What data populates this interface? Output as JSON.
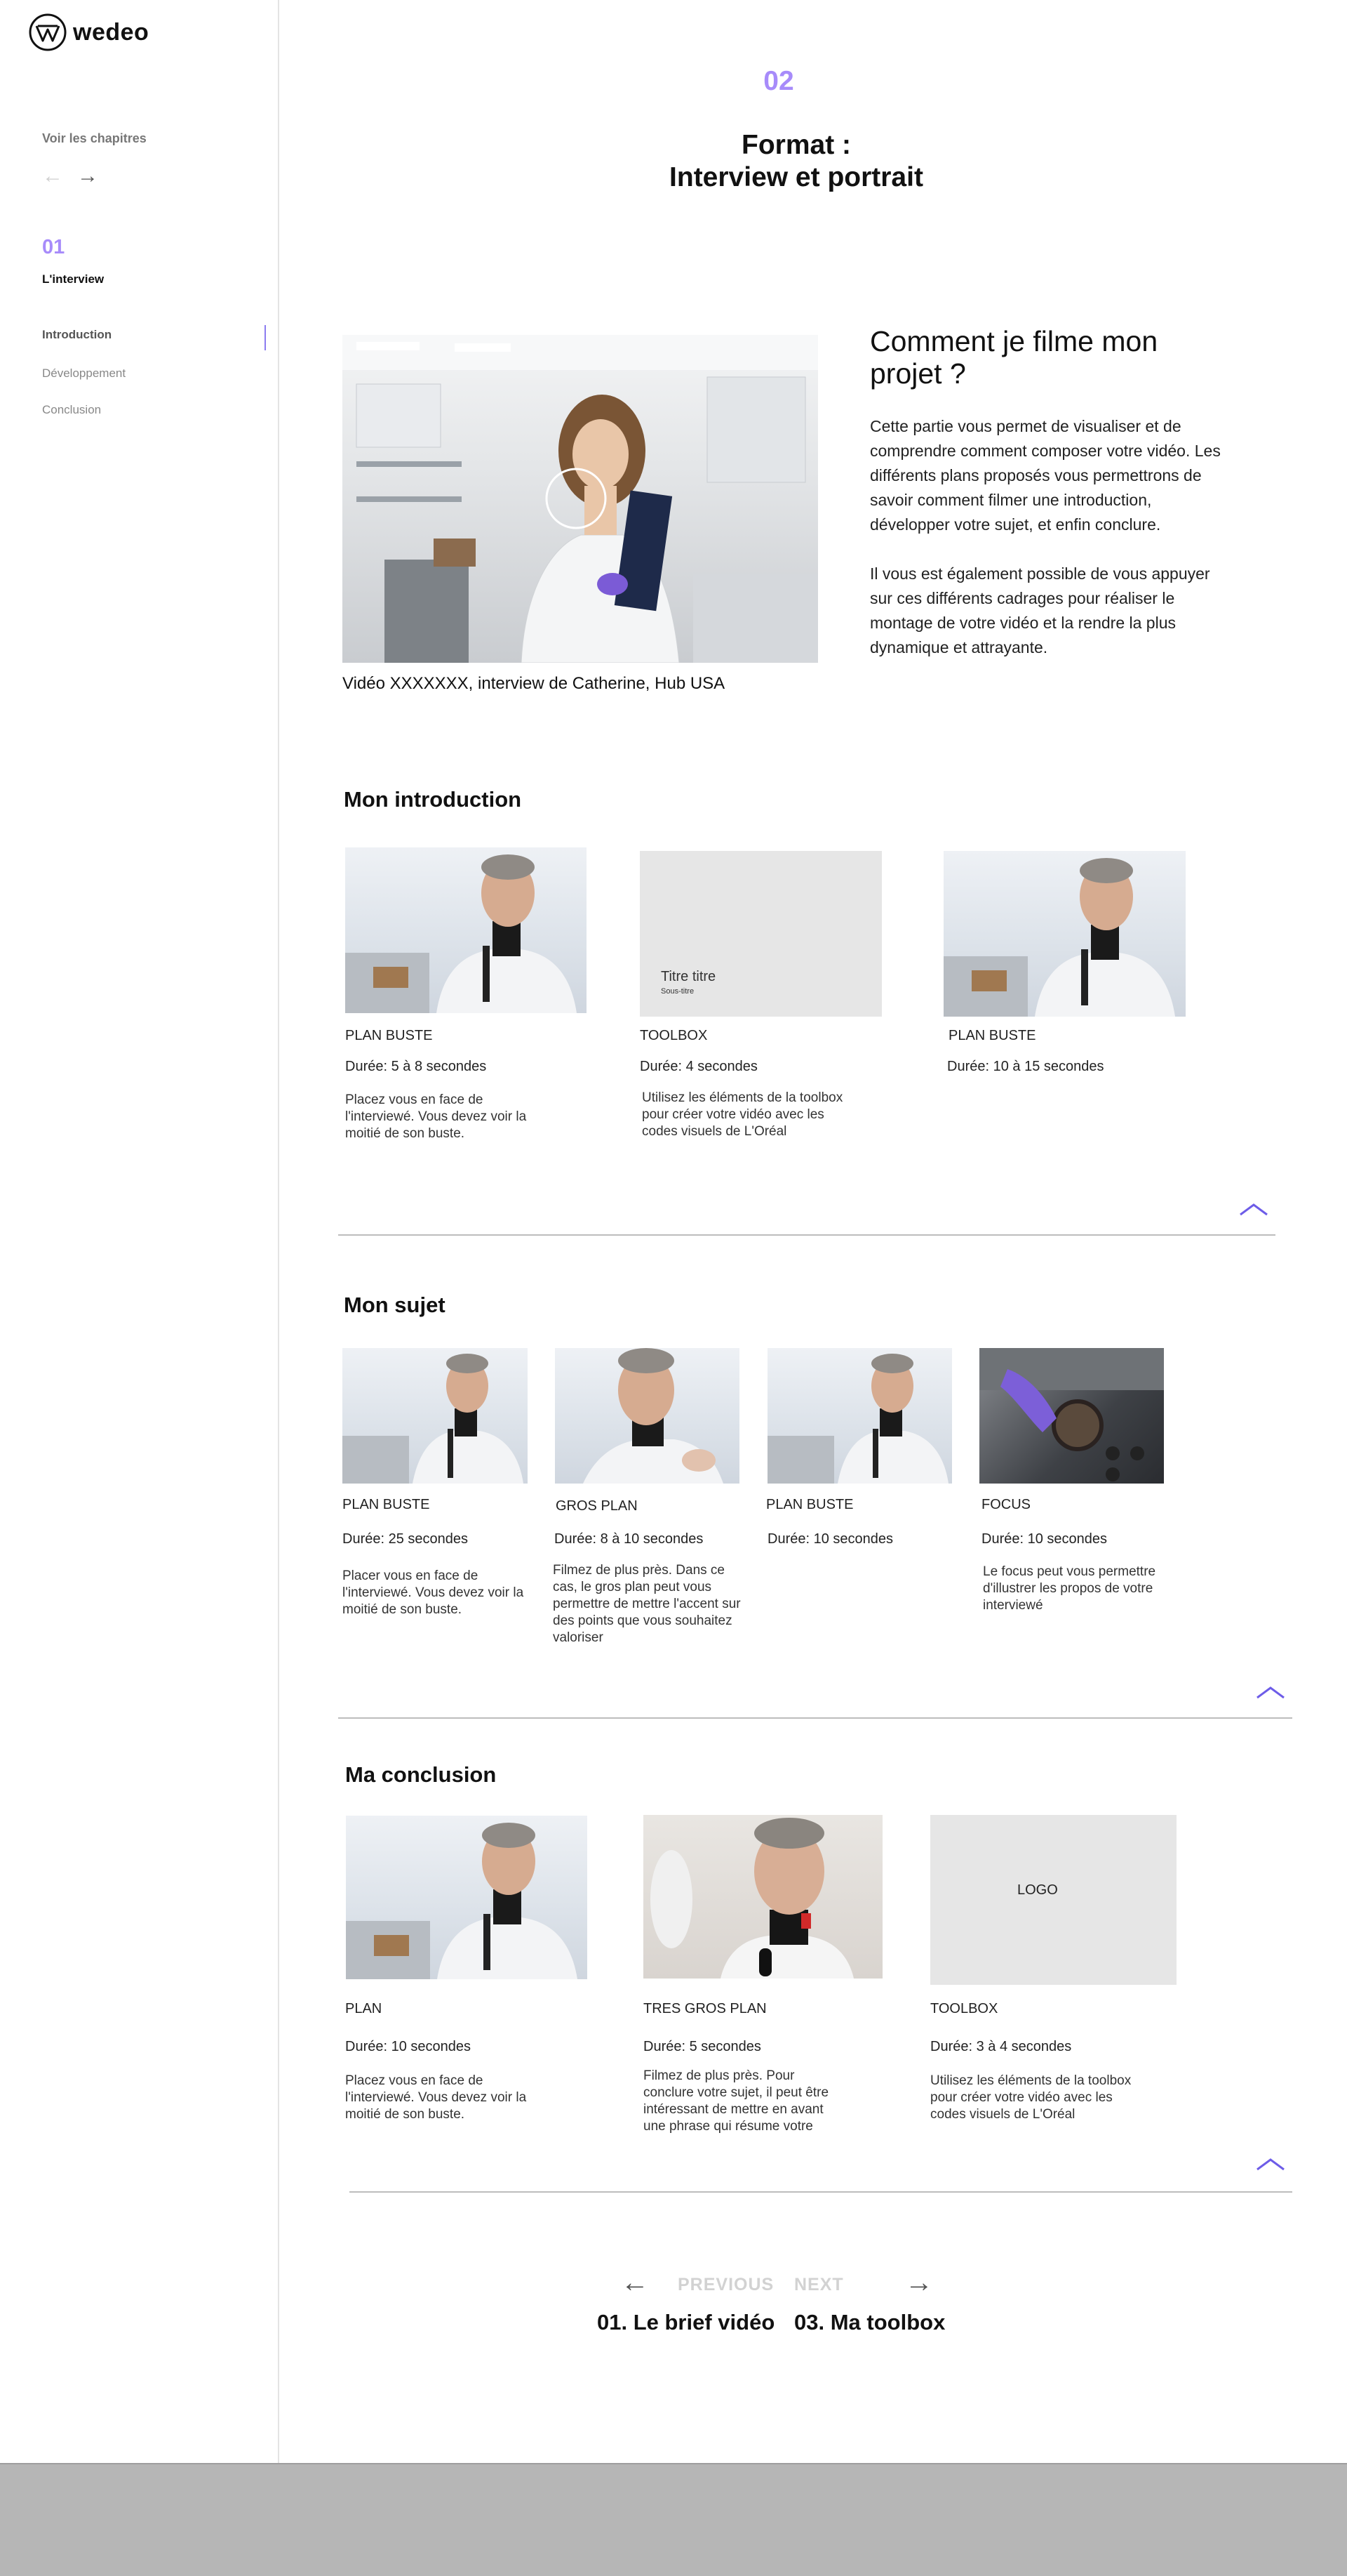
{
  "brand": {
    "name": "wedeo"
  },
  "sidebar": {
    "see_chapters": "Voir les chapitres",
    "prev_arrow": "←",
    "next_arrow": "→",
    "chapter_num": "01",
    "chapter_title": "L'interview",
    "items": [
      {
        "label": "Introduction",
        "active": true
      },
      {
        "label": "Développement",
        "active": false
      },
      {
        "label": "Conclusion",
        "active": false
      }
    ]
  },
  "header": {
    "section_num": "02",
    "title_line1": "Format :",
    "title_line2": "Interview et portrait"
  },
  "intro": {
    "heading": "Comment je filme mon projet ?",
    "p1": "Cette partie vous permet de visualiser et de comprendre comment composer votre vidéo. Les différents plans proposés vous permettrons de savoir comment filmer une introduction, développer votre sujet, et enfin conclure.",
    "p2": "Il vous est également possible de vous appuyer sur ces différents cadrages pour réaliser le montage de votre vidéo et la rendre la plus dynamique et attrayante.",
    "caption": "Vidéo XXXXXXX, interview de Catherine, Hub USA"
  },
  "sections": {
    "introduction": {
      "heading": "Mon introduction",
      "cards": [
        {
          "label": "PLAN BUSTE",
          "duration": "Durée: 5 à 8 secondes",
          "desc": "Placez vous en face de l'interviewé. Vous devez voir la moitié de son buste."
        },
        {
          "label": "TOOLBOX",
          "duration": "Durée: 4 secondes",
          "desc": "Utilisez les éléments de la toolbox pour créer votre vidéo avec les codes visuels de L'Oréal",
          "box_title": "Titre titre",
          "box_sub": "Sous-titre"
        },
        {
          "label": "PLAN BUSTE",
          "duration": "Durée: 10 à 15 secondes",
          "desc": ""
        }
      ]
    },
    "sujet": {
      "heading": "Mon sujet",
      "cards": [
        {
          "label": "PLAN BUSTE",
          "duration": "Durée: 25 secondes",
          "desc": "Placer vous en face de l'interviewé. Vous devez voir la moitié de son buste."
        },
        {
          "label": "GROS PLAN",
          "duration": "Durée: 8 à 10 secondes",
          "desc": "Filmez de plus près. Dans ce cas, le gros plan peut vous permettre de mettre l'accent sur des points que vous souhaitez valoriser"
        },
        {
          "label": "PLAN BUSTE",
          "duration": "Durée: 10 secondes",
          "desc": ""
        },
        {
          "label": "FOCUS",
          "duration": "Durée: 10 secondes",
          "desc": "Le focus peut vous permettre d'illustrer les propos de votre interviewé"
        }
      ]
    },
    "conclusion": {
      "heading": "Ma conclusion",
      "cards": [
        {
          "label": "PLAN",
          "duration": "Durée: 10 secondes",
          "desc": "Placez vous en face de l'interviewé. Vous devez voir la moitié de son buste."
        },
        {
          "label": "TRES GROS PLAN",
          "duration": "Durée: 5 secondes",
          "desc": "Filmez de plus près. Pour conclure votre sujet, il peut être intéressant de mettre en avant une phrase qui résume votre"
        },
        {
          "label": "TOOLBOX",
          "duration": "Durée: 3 à 4 secondes",
          "desc": "Utilisez les éléments de la toolbox pour créer votre vidéo avec les codes visuels de L'Oréal",
          "box_text": "LOGO"
        }
      ]
    }
  },
  "pager": {
    "prev_label": "PREVIOUS",
    "next_label": "NEXT",
    "prev_title": "01. Le brief vidéo",
    "next_title": "03. Ma toolbox",
    "prev_arrow": "←",
    "next_arrow": "→"
  },
  "colors": {
    "accent": "#a78bfa",
    "chevron": "#6d5ce8"
  }
}
